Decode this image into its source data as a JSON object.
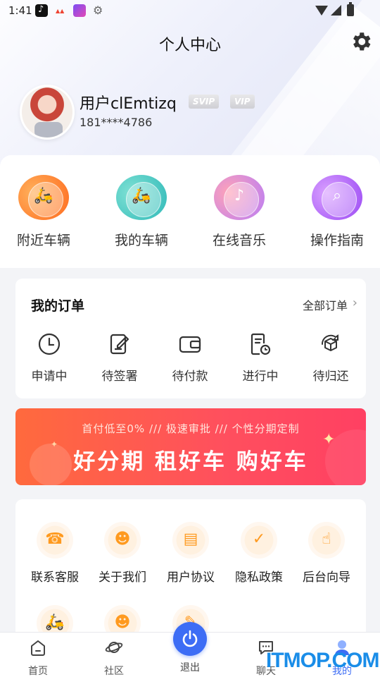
{
  "status_bar": {
    "time": "1:41"
  },
  "header": {
    "title": "个人中心"
  },
  "profile": {
    "username": "用户clEmtizq",
    "phone": "181****4786",
    "badges": [
      "SVIP",
      "VIP"
    ]
  },
  "quick_entries": [
    {
      "label": "附近车辆",
      "icon": "nearby-scooter-icon",
      "glyph": "🛵"
    },
    {
      "label": "我的车辆",
      "icon": "my-scooter-icon",
      "glyph": "🛵"
    },
    {
      "label": "在线音乐",
      "icon": "music-phone-icon",
      "glyph": "♪"
    },
    {
      "label": "操作指南",
      "icon": "guide-search-icon",
      "glyph": "⌕"
    }
  ],
  "orders": {
    "title": "我的订单",
    "all_label": "全部订单",
    "items": [
      {
        "label": "申请中",
        "icon": "clock-icon"
      },
      {
        "label": "待签署",
        "icon": "sign-document-icon"
      },
      {
        "label": "待付款",
        "icon": "wallet-icon"
      },
      {
        "label": "进行中",
        "icon": "document-clock-icon"
      },
      {
        "label": "待归还",
        "icon": "box-return-icon"
      }
    ]
  },
  "banner": {
    "top_text": "首付低至0%  ///  极速审批  ///  个性分期定制",
    "main_text": "好分期  租好车  购好车"
  },
  "services": [
    {
      "label": "联系客服",
      "icon": "customer-service-icon",
      "glyph": "☎"
    },
    {
      "label": "关于我们",
      "icon": "person-icon",
      "glyph": "☻"
    },
    {
      "label": "用户协议",
      "icon": "document-icon",
      "glyph": "▤"
    },
    {
      "label": "隐私政策",
      "icon": "shield-check-icon",
      "glyph": "✓"
    },
    {
      "label": "后台向导",
      "icon": "hand-pointer-icon",
      "glyph": "☝"
    },
    {
      "label": "",
      "icon": "scooter-icon",
      "glyph": "🛵"
    },
    {
      "label": "",
      "icon": "manager-icon",
      "glyph": "☻"
    },
    {
      "label": "",
      "icon": "tag-icon",
      "glyph": "✎"
    }
  ],
  "tabbar": {
    "items": [
      {
        "label": "首页",
        "icon": "home-icon"
      },
      {
        "label": "社区",
        "icon": "planet-icon"
      },
      {
        "label": "退出",
        "icon": "power-icon"
      },
      {
        "label": "聊天",
        "icon": "chat-icon"
      },
      {
        "label": "我的",
        "icon": "profile-icon"
      }
    ],
    "active": "我的"
  },
  "watermark": "ITMOP.COM",
  "colors": {
    "accent": "#3d6df5",
    "banner": "#ff5252",
    "service_icon": "#ff9a1f"
  }
}
